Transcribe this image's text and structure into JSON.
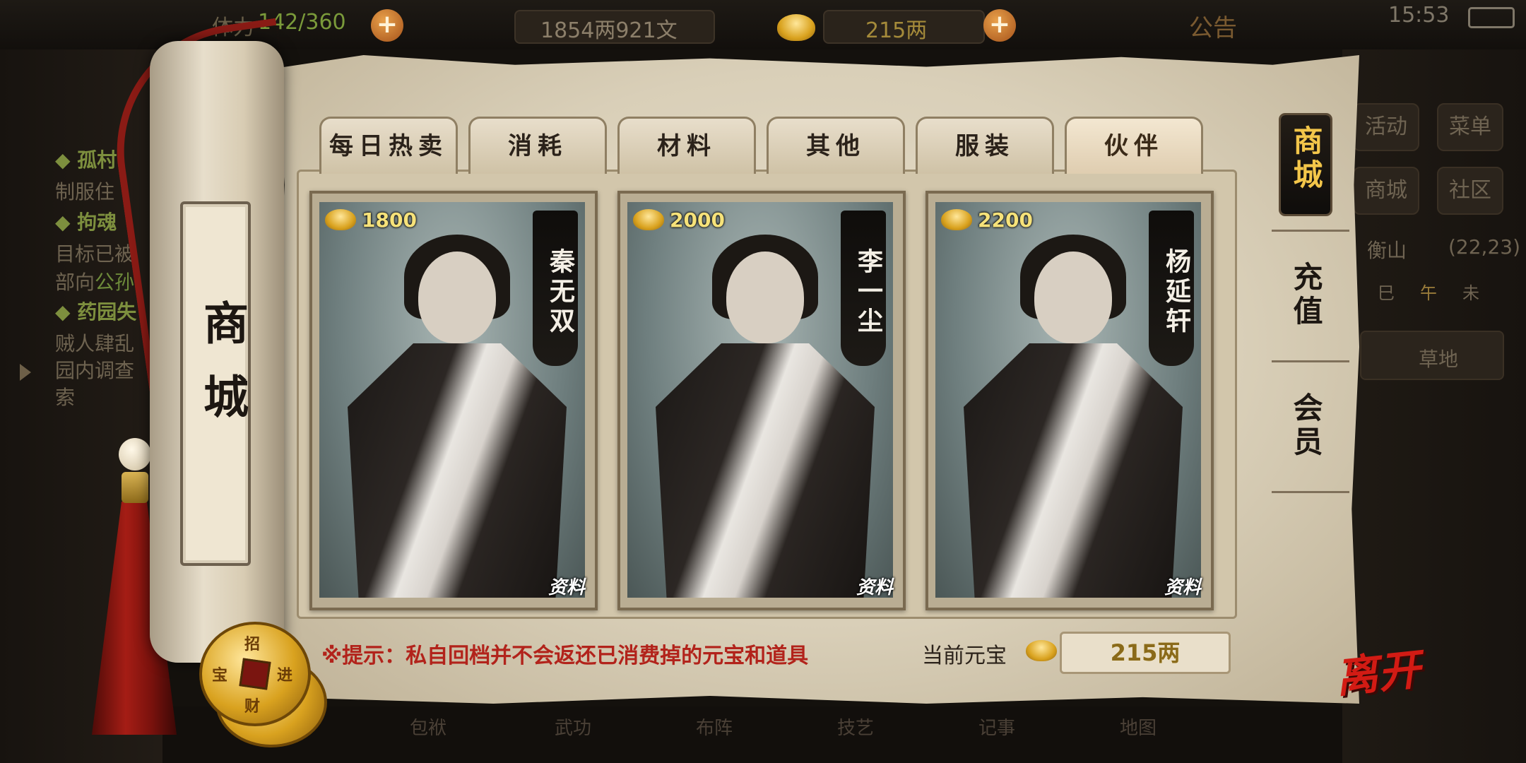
{
  "hud": {
    "stamina_label": "体力",
    "stamina": "142/360",
    "silver": "1854两921文",
    "gold": "215两",
    "notice": "公告",
    "time": "15:53"
  },
  "quests": [
    {
      "title": "◆ 孤村",
      "desc": [
        "制服住"
      ]
    },
    {
      "title": "◆ 拘魂",
      "desc": [
        "目标已被",
        "部向",
        "公孙"
      ]
    },
    {
      "title": "◆ 药园失",
      "desc": [
        "贼人肆乱",
        "园内调查",
        "索"
      ]
    }
  ],
  "right_menu": {
    "activity": "活动",
    "menu": "菜单",
    "shop": "商城",
    "community": "社区",
    "location": "衡山",
    "coords": "(22,23)",
    "time_marks": [
      "巳",
      "午",
      "未"
    ],
    "terrain": "草地"
  },
  "bottom_nav": [
    "包袱",
    "武功",
    "布阵",
    "技艺",
    "记事",
    "地图"
  ],
  "scroll_title": "商城",
  "tabs": [
    "每日热卖",
    "消耗",
    "材料",
    "其他",
    "服装",
    "伙伴"
  ],
  "active_tab": "伙伴",
  "cards": [
    {
      "name": "秦无双",
      "price": "1800",
      "info": "资料"
    },
    {
      "name": "李一尘",
      "price": "2000",
      "info": "资料"
    },
    {
      "name": "杨延轩",
      "price": "2200",
      "info": "资料"
    }
  ],
  "hint": "※提示：私自回档并不会返还已消费掉的元宝和道具",
  "currency_label": "当前元宝",
  "currency_value": "215两",
  "side_menu": [
    "商城",
    "充值",
    "会员"
  ],
  "coin_text": [
    "招",
    "财",
    "进",
    "宝"
  ],
  "leave": "离开",
  "colors": {
    "accent_red": "#b2231b",
    "gold": "#f6e27a",
    "paper": "#e2d8c3"
  }
}
